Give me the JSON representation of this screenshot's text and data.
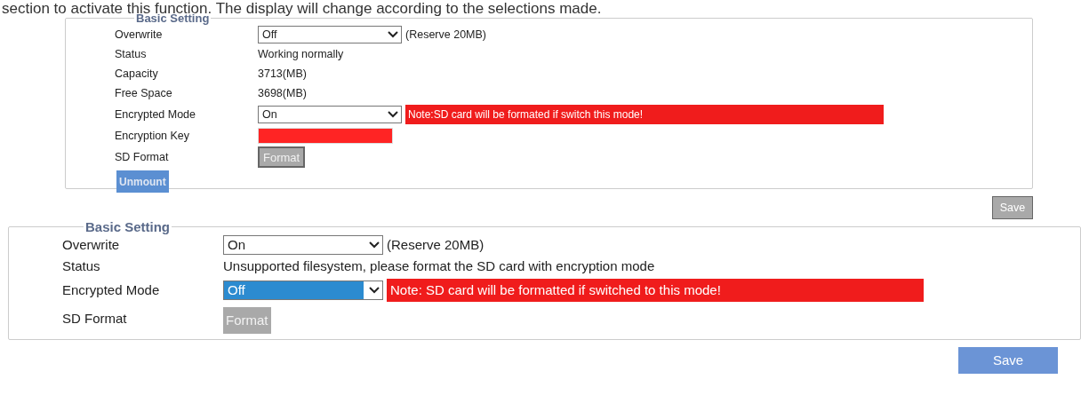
{
  "intro": "section to activate this function. The display will change according to the selections made.",
  "panels": [
    {
      "kind": "compact",
      "legend": "Basic Setting",
      "rows": [
        {
          "kind": "select",
          "label": "Overwrite",
          "value": "Off",
          "highlighted": false,
          "note": "(Reserve 20MB)"
        },
        {
          "kind": "text",
          "label": "Status",
          "value": "Working normally"
        },
        {
          "kind": "text",
          "label": "Capacity",
          "value": "3713(MB)"
        },
        {
          "kind": "text",
          "label": "Free Space",
          "value": "3698(MB)"
        },
        {
          "kind": "select",
          "label": "Encrypted Mode",
          "value": "On",
          "highlighted": false,
          "warning": "Note:SD card will be formated if switch this mode!"
        },
        {
          "kind": "key",
          "label": "Encryption Key"
        },
        {
          "kind": "button",
          "label": "SD Format",
          "button": "Format",
          "disabled": true
        }
      ],
      "unmount": "Unmount",
      "save": {
        "label": "Save",
        "disabled": true
      }
    },
    {
      "kind": "large",
      "legend": "Basic Setting",
      "rows": [
        {
          "kind": "select",
          "label": "Overwrite",
          "value": "On",
          "highlighted": false,
          "note": "(Reserve 20MB)"
        },
        {
          "kind": "text",
          "label": "Status",
          "value": "Unsupported filesystem, please format the SD card with encryption mode"
        },
        {
          "kind": "select",
          "label": "Encrypted Mode",
          "value": "Off",
          "highlighted": true,
          "warning": "Note: SD card will be formatted if switched to this mode!"
        },
        {
          "kind": "button",
          "label": "SD Format",
          "button": "Format",
          "disabled": true
        }
      ],
      "save": {
        "label": "Save",
        "disabled": false
      }
    }
  ]
}
